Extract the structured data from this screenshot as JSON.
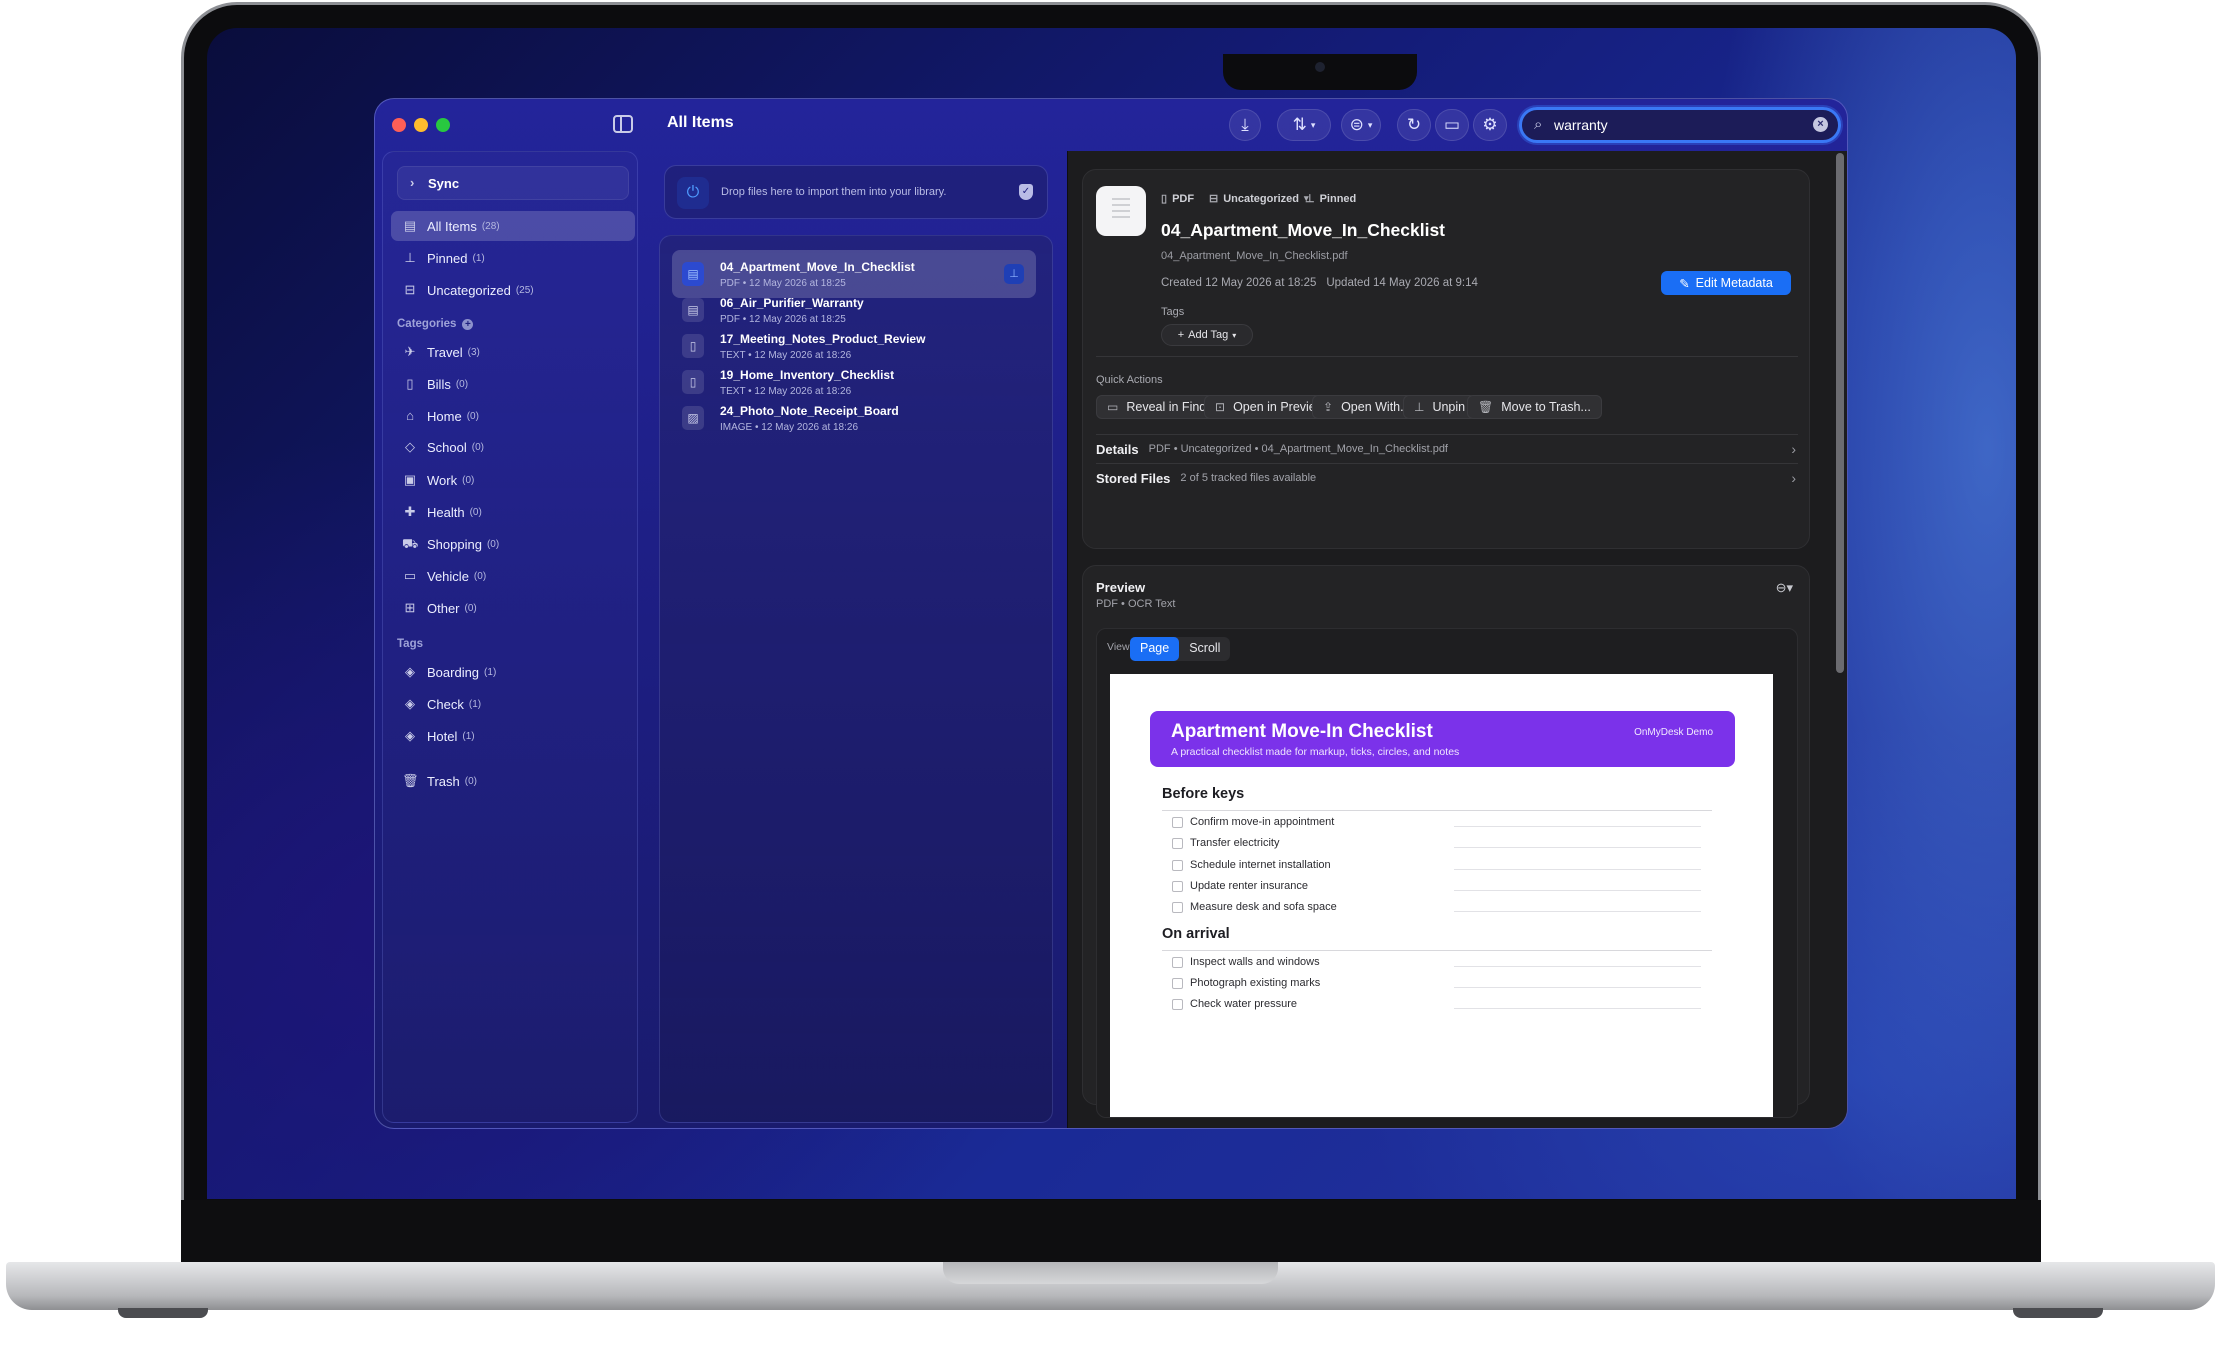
{
  "window": {
    "title": "All Items"
  },
  "search": {
    "value": "warranty",
    "placeholder": ""
  },
  "toolbar": {
    "icons": [
      "import-icon",
      "sort-icon",
      "filter-icon",
      "refresh-icon",
      "folder-icon",
      "gear-icon"
    ]
  },
  "sidebar": {
    "sync_label": "Sync",
    "library": [
      {
        "label": "All Items",
        "count": "(28)",
        "icon": "tray-icon",
        "active": true
      },
      {
        "label": "Pinned",
        "count": "(1)",
        "icon": "pin-icon",
        "active": false
      },
      {
        "label": "Uncategorized",
        "count": "(25)",
        "icon": "inbox-icon",
        "active": false
      }
    ],
    "categories_label": "Categories",
    "categories": [
      {
        "label": "Travel",
        "count": "(3)",
        "icon": "airplane-icon"
      },
      {
        "label": "Bills",
        "count": "(0)",
        "icon": "document-icon"
      },
      {
        "label": "Home",
        "count": "(0)",
        "icon": "house-icon"
      },
      {
        "label": "School",
        "count": "(0)",
        "icon": "graduation-cap-icon"
      },
      {
        "label": "Work",
        "count": "(0)",
        "icon": "briefcase-icon"
      },
      {
        "label": "Health",
        "count": "(0)",
        "icon": "cross-icon"
      },
      {
        "label": "Shopping",
        "count": "(0)",
        "icon": "cart-icon"
      },
      {
        "label": "Vehicle",
        "count": "(0)",
        "icon": "car-icon"
      },
      {
        "label": "Other",
        "count": "(0)",
        "icon": "grid-icon"
      }
    ],
    "tags_label": "Tags",
    "tags": [
      {
        "label": "Boarding",
        "count": "(1)",
        "icon": "tag-icon"
      },
      {
        "label": "Check",
        "count": "(1)",
        "icon": "tag-icon"
      },
      {
        "label": "Hotel",
        "count": "(1)",
        "icon": "tag-icon"
      }
    ],
    "trash": {
      "label": "Trash",
      "count": "(0)",
      "icon": "trash-icon"
    }
  },
  "dropzone": {
    "text": "Drop files here to import them into your library."
  },
  "list": [
    {
      "title": "04_Apartment_Move_In_Checklist",
      "meta": "PDF • 12 May 2026 at 18:25",
      "selected": true,
      "pinned": true
    },
    {
      "title": "06_Air_Purifier_Warranty",
      "meta": "PDF • 12 May 2026 at 18:25",
      "selected": false,
      "pinned": false
    },
    {
      "title": "17_Meeting_Notes_Product_Review",
      "meta": "TEXT • 12 May 2026 at 18:26",
      "selected": false,
      "pinned": false
    },
    {
      "title": "19_Home_Inventory_Checklist",
      "meta": "TEXT • 12 May 2026 at 18:26",
      "selected": false,
      "pinned": false
    },
    {
      "title": "24_Photo_Note_Receipt_Board",
      "meta": "IMAGE • 12 May 2026 at 18:26",
      "selected": false,
      "pinned": false
    }
  ],
  "detail": {
    "chips": {
      "type": "PDF",
      "category": "Uncategorized",
      "pinned": "Pinned"
    },
    "title": "04_Apartment_Move_In_Checklist",
    "filename": "04_Apartment_Move_In_Checklist.pdf",
    "created": "Created 12 May 2026 at 18:25",
    "updated": "Updated 14 May 2026 at 9:14",
    "edit_label": "Edit Metadata",
    "tags_label": "Tags",
    "add_tag_label": "Add Tag",
    "quick_actions_label": "Quick Actions",
    "quick_actions": [
      "Reveal in Finder",
      "Open in Preview",
      "Open With...",
      "Unpin",
      "Move to Trash..."
    ],
    "details_label": "Details",
    "details_value": "PDF • Uncategorized • 04_Apartment_Move_In_Checklist.pdf",
    "stored_label": "Stored Files",
    "stored_value": "2 of 5 tracked files available"
  },
  "preview": {
    "title": "Preview",
    "subtitle": "PDF • OCR Text",
    "view_label": "View",
    "modes": [
      "Page",
      "Scroll"
    ],
    "active_mode": "Page",
    "doc": {
      "title": "Apartment Move-In Checklist",
      "subtitle": "A practical checklist made for markup, ticks, circles, and notes",
      "brand": "OnMyDesk Demo",
      "banner_color": "#7b32ea",
      "sections": [
        {
          "heading": "Before keys",
          "items": [
            "Confirm move-in appointment",
            "Transfer electricity",
            "Schedule internet installation",
            "Update renter insurance",
            "Measure desk and sofa space"
          ]
        },
        {
          "heading": "On arrival",
          "items": [
            "Inspect walls and windows",
            "Photograph existing marks",
            "Check water pressure"
          ]
        }
      ]
    }
  },
  "colors": {
    "accent": "#1a6ef5",
    "window_bg": "#23249a",
    "detail_bg": "#1c1c1e"
  }
}
